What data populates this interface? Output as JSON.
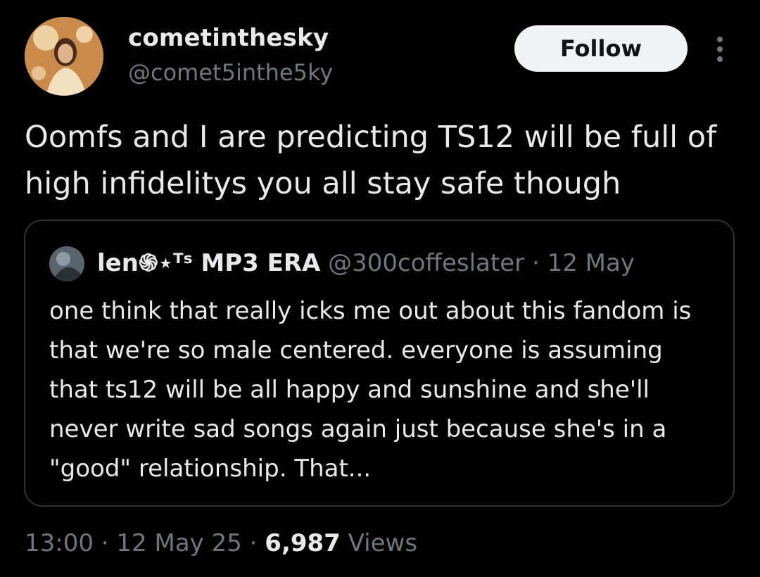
{
  "author": {
    "display_name": "cometinthesky",
    "handle": "@comet5inthe5ky"
  },
  "follow_label": "Follow",
  "more_icon": "more-vertical-icon",
  "tweet": {
    "text": "Oomfs and I are predicting TS12 will be full of high infidelitys you all stay safe though"
  },
  "quote": {
    "display_name": "len֍⋆ᵀˢ MP3 ERA",
    "handle": "@300coffeslater",
    "separator": "·",
    "date": "12 May",
    "text": "one think that really icks me out about this fandom is that we're so male centered. everyone is assuming that ts12 will be all happy and sunshine and she'll never write sad songs again just because she's in a \"good\" relationship. That..."
  },
  "meta": {
    "time": "13:00",
    "separator": "·",
    "date": "12 May 25",
    "views_count": "6,987",
    "views_label": "Views"
  },
  "colors": {
    "background": "#000000",
    "text": "#e7e9ea",
    "secondary": "#71767b",
    "border": "#2f3336",
    "button_bg": "#eff3f4"
  }
}
